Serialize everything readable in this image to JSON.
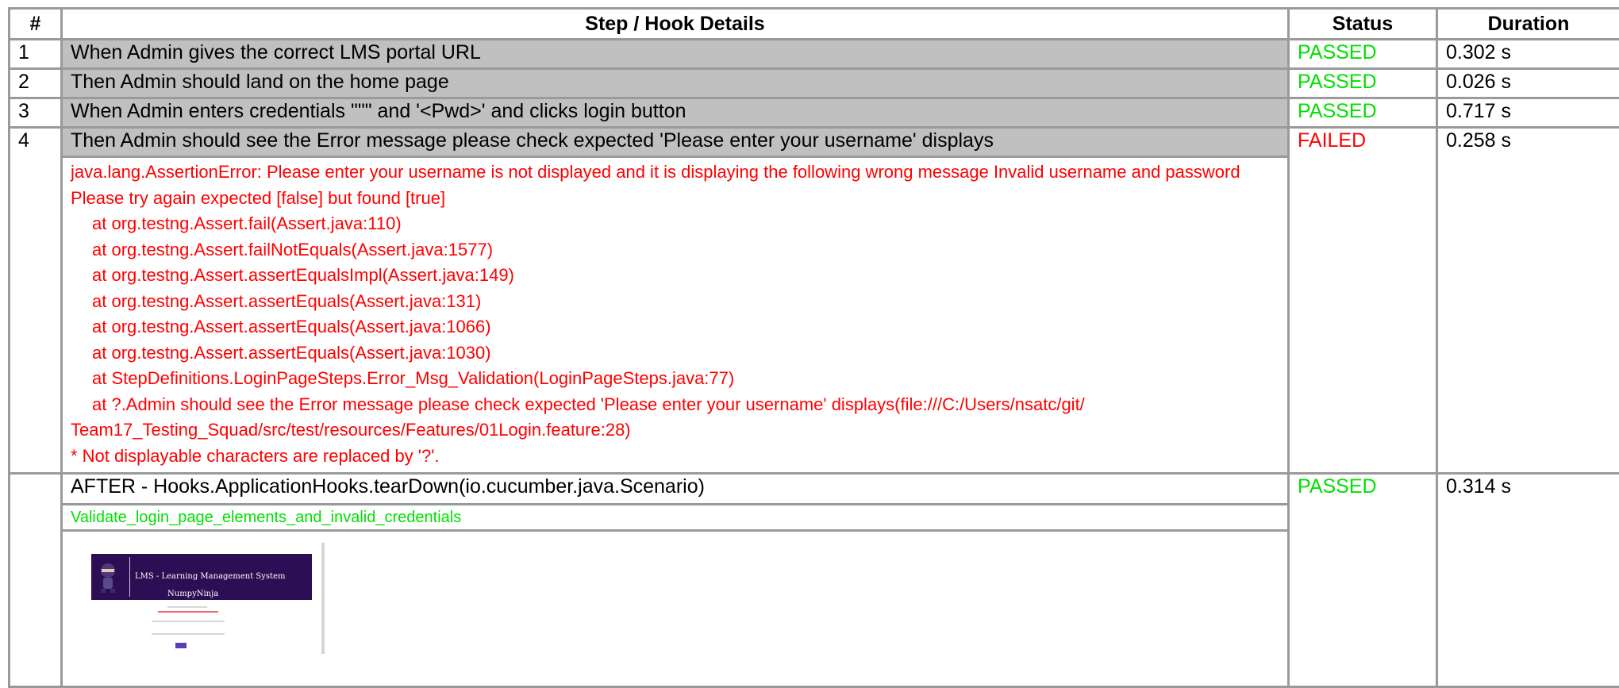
{
  "headers": {
    "num": "#",
    "details": "Step / Hook Details",
    "status": "Status",
    "duration": "Duration"
  },
  "steps": [
    {
      "num": "1",
      "text": "When Admin gives the correct LMS portal URL",
      "status": "PASSED",
      "duration": "0.302 s"
    },
    {
      "num": "2",
      "text": "Then Admin should land on the home page",
      "status": "PASSED",
      "duration": "0.026 s"
    },
    {
      "num": "3",
      "text": "When Admin enters credentials \"\"\" and '<Pwd>' and clicks login button",
      "status": "PASSED",
      "duration": "0.717 s"
    },
    {
      "num": "4",
      "text": "Then Admin should see the Error message please check expected 'Please enter your username' displays",
      "status": "FAILED",
      "duration": "0.258 s"
    }
  ],
  "error": {
    "message": "java.lang.AssertionError: Please enter your username is not displayed and it is displaying the following wrong message Invalid username and password Please try again expected [false] but found [true]",
    "trace": [
      "at org.testng.Assert.fail(Assert.java:110)",
      "at org.testng.Assert.failNotEquals(Assert.java:1577)",
      "at org.testng.Assert.assertEqualsImpl(Assert.java:149)",
      "at org.testng.Assert.assertEquals(Assert.java:131)",
      "at org.testng.Assert.assertEquals(Assert.java:1066)",
      "at org.testng.Assert.assertEquals(Assert.java:1030)",
      "at StepDefinitions.LoginPageSteps.Error_Msg_Validation(LoginPageSteps.java:77)"
    ],
    "feature_line_1": "at ?.Admin should see the Error message please check expected 'Please enter your username' displays(file:///C:/Users/nsatc/git/",
    "feature_line_2": "Team17_Testing_Squad/src/test/resources/Features/01Login.feature:28)",
    "note": "* Not displayable characters are replaced by '?'."
  },
  "hook": {
    "text": "AFTER - Hooks.ApplicationHooks.tearDown(io.cucumber.java.Scenario)",
    "status": "PASSED",
    "duration": "0.314 s",
    "scenario_name": "Validate_login_page_elements_and_invalid_credentials",
    "screenshot": {
      "title": "LMS - Learning Management System",
      "brand": "NumpyNinja",
      "mascot_icon": "ninja-mascot-icon"
    }
  },
  "colors": {
    "passed": "#00e000",
    "failed": "#ff0000",
    "step_bg": "#c0c0c0",
    "border": "#9a9a9a",
    "banner": "#2b0e54"
  }
}
